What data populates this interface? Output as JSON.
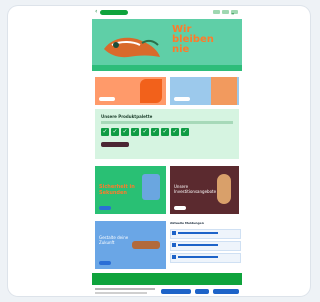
{
  "hero": {
    "title_line1": "Wir",
    "title_line2": "bleiben",
    "title_line3": "nie"
  },
  "form": {
    "title": "Unsere Produktpalette"
  },
  "tiles": {
    "green_text": "Sicherheit in Sekunden",
    "brown_text": "Unsere Investitionsangebote",
    "blue_text": "Gestalte deine Zukunft"
  },
  "news": {
    "title": "Aktuelle Meldungen"
  },
  "colors": {
    "brand_green": "#0fa33c",
    "accent_orange": "#ff7a2a"
  }
}
